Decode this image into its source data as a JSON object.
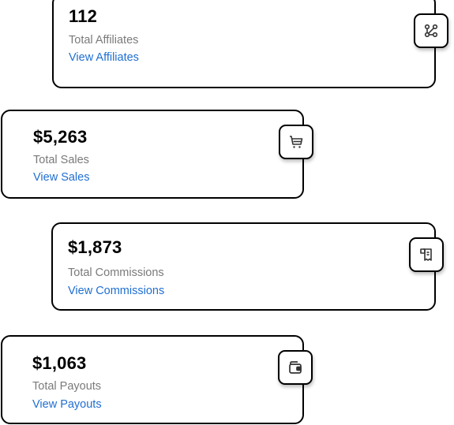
{
  "cards": [
    {
      "id": "affiliates",
      "value": "112",
      "label": "Total Affiliates",
      "link": "View Affiliates",
      "icon": "affiliate-network-icon"
    },
    {
      "id": "sales",
      "value": "$5,263",
      "label": "Total Sales",
      "link": "View Sales",
      "icon": "shopping-cart-icon"
    },
    {
      "id": "commissions",
      "value": "$1,873",
      "label": "Total Commissions",
      "link": "View Commissions",
      "icon": "receipt-icon"
    },
    {
      "id": "payouts",
      "value": "$1,063",
      "label": "Total Payouts",
      "link": "View Payouts",
      "icon": "wallet-icon"
    }
  ],
  "colors": {
    "border": "#000000",
    "value_text": "#000000",
    "label_text": "#7a7a7a",
    "link_text": "#1f6fd1",
    "icon_stroke": "#333333"
  }
}
